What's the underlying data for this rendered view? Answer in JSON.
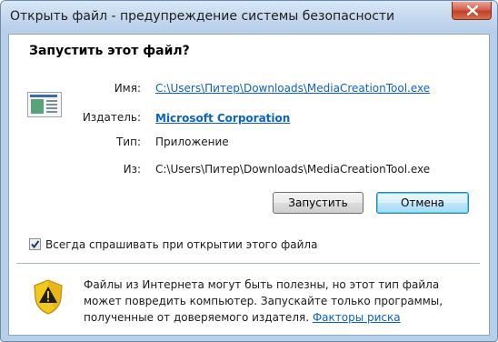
{
  "window": {
    "title": "Открыть файл - предупреждение системы безопасности"
  },
  "dialog": {
    "heading": "Запустить этот файл?",
    "fields": {
      "name_label": "Имя:",
      "name_value": "C:\\Users\\Питер\\Downloads\\MediaCreationTool.exe",
      "publisher_label": "Издатель:",
      "publisher_value": "Microsoft Corporation",
      "type_label": "Тип:",
      "type_value": "Приложение",
      "from_label": "Из:",
      "from_value": "C:\\Users\\Питер\\Downloads\\MediaCreationTool.exe"
    },
    "buttons": {
      "run": "Запустить",
      "cancel": "Отмена"
    },
    "checkbox": {
      "label": "Всегда спрашивать при открытии этого файла",
      "checked": true
    },
    "warning": {
      "text": "Файлы из Интернета могут быть полезны, но этот тип файла может повредить компьютер. Запускайте только программы, полученные от доверяемого издателя.",
      "link": "Факторы риска"
    }
  },
  "icons": {
    "close": "close-icon",
    "file": "application-icon",
    "shield": "security-shield-icon",
    "check": "checkmark-icon"
  },
  "colors": {
    "link": "#0b62c7",
    "shield_yellow": "#f2c81c",
    "title_bg": "#c6daef"
  }
}
